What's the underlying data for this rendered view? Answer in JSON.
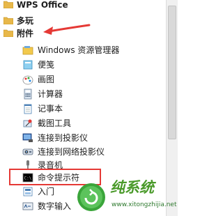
{
  "menu": {
    "items": [
      {
        "label": "WPS Office",
        "type": "folder",
        "icon": "folder-icon"
      },
      {
        "label": "多玩",
        "type": "folder",
        "icon": "folder-icon"
      },
      {
        "label": "附件",
        "type": "folder",
        "icon": "folder-icon"
      },
      {
        "label": "Windows 资源管理器",
        "type": "app",
        "icon": "explorer-icon"
      },
      {
        "label": "便笺",
        "type": "app",
        "icon": "sticky-notes-icon"
      },
      {
        "label": "画图",
        "type": "app",
        "icon": "paint-icon"
      },
      {
        "label": "计算器",
        "type": "app",
        "icon": "calculator-icon"
      },
      {
        "label": "记事本",
        "type": "app",
        "icon": "notepad-icon"
      },
      {
        "label": "截图工具",
        "type": "app",
        "icon": "snipping-tool-icon"
      },
      {
        "label": "连接到投影仪",
        "type": "app",
        "icon": "projector-icon"
      },
      {
        "label": "连接到网络投影仪",
        "type": "app",
        "icon": "network-projector-icon"
      },
      {
        "label": "录音机",
        "type": "app",
        "icon": "microphone-icon"
      },
      {
        "label": "命令提示符",
        "type": "app",
        "icon": "command-prompt-icon"
      },
      {
        "label": "入门",
        "type": "app",
        "icon": "getting-started-icon"
      },
      {
        "label": "数字输入",
        "type": "app",
        "icon": "math-input-icon"
      }
    ]
  },
  "watermark": {
    "title": "纯系统",
    "url": "www.xitongzhijia.net"
  },
  "colors": {
    "annotation": "#e53935",
    "folder": "#e8b84a",
    "watermark_green": "#3aa53a"
  }
}
